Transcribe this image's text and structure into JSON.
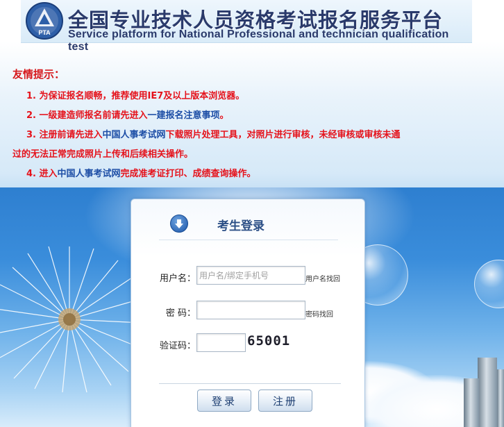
{
  "header": {
    "title_cn": "全国专业技术人员资格考试报名服务平台",
    "title_en": "Service platform for National Professional and technician qualification test",
    "logo_text": "PTA"
  },
  "notice": {
    "title": "友情提示：",
    "item1": "1. 为保证报名顺畅，推荐使用IE7及以上版本浏览器。",
    "item2_prefix": "2. 一级建造师报名前请先进入",
    "item2_link": "一建报名注意事项",
    "item2_suffix": "。",
    "item3_prefix": "3. 注册前请先进入",
    "item3_link": "中国人事考试网",
    "item3_suffix": "下载照片处理工具，对照片进行审核，未经审核或审核未通",
    "item3_cont": "过的无法正常完成照片上传和后续相关操作。",
    "item4_prefix": "4. 进入",
    "item4_link": "中国人事考试网",
    "item4_suffix": "完成准考证打印、成绩查询操作。"
  },
  "login": {
    "title": "考生登录",
    "username_label": "用户名：",
    "username_placeholder": "用户名/绑定手机号",
    "username_recover": "用户名找回",
    "password_label": "密 码：",
    "password_recover": "密码找回",
    "captcha_label": "验证码：",
    "captcha_text": "65001",
    "login_button": "登录",
    "register_button": "注册"
  },
  "colors": {
    "notice_red": "#e5121b",
    "link_blue": "#1d4ea6",
    "title_navy": "#2a3a6b"
  }
}
